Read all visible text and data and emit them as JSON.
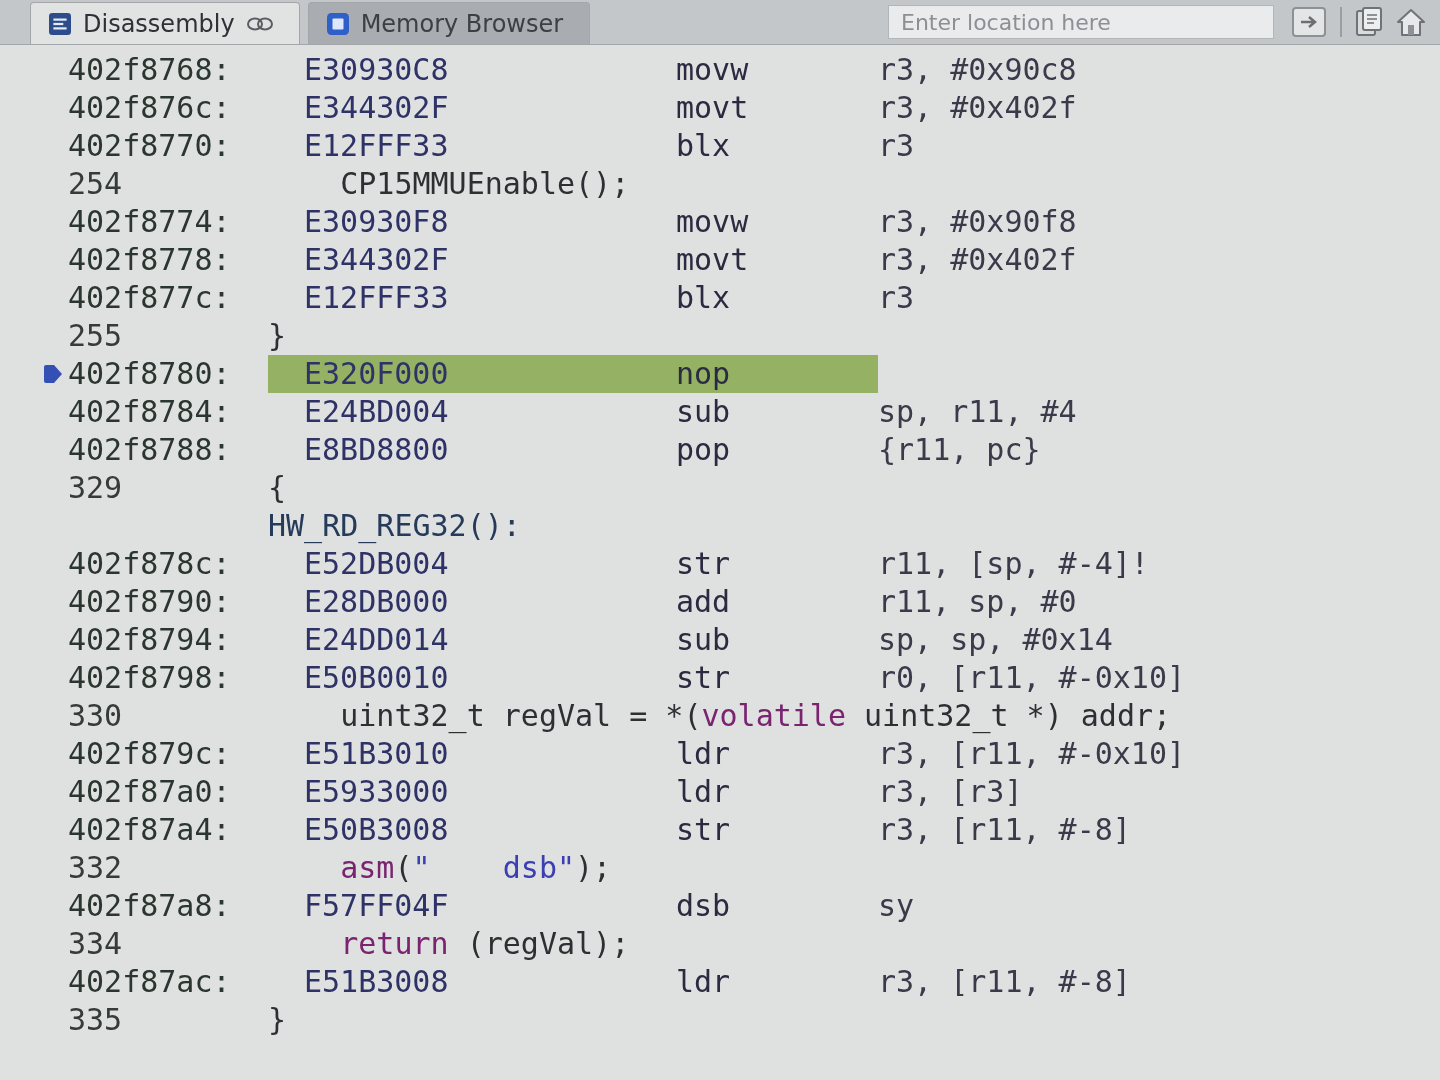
{
  "tabs": [
    {
      "label": "Disassembly",
      "selected": true
    },
    {
      "label": "Memory Browser",
      "selected": false
    }
  ],
  "location_field": {
    "placeholder": "Enter location here"
  },
  "rows": [
    {
      "kind": "instruction",
      "address": "402f8768:",
      "opcode": "E30930C8",
      "mnemonic": "movw",
      "operands": "r3, #0x90c8",
      "current": false
    },
    {
      "kind": "instruction",
      "address": "402f876c:",
      "opcode": "E344302F",
      "mnemonic": "movt",
      "operands": "r3, #0x402f",
      "current": false
    },
    {
      "kind": "instruction",
      "address": "402f8770:",
      "opcode": "E12FFF33",
      "mnemonic": "blx",
      "operands": "r3",
      "current": false
    },
    {
      "kind": "source",
      "line": "254",
      "code": [
        {
          "kind": "plain",
          "text": "    CP15MMUEnable();"
        }
      ]
    },
    {
      "kind": "instruction",
      "address": "402f8774:",
      "opcode": "E30930F8",
      "mnemonic": "movw",
      "operands": "r3, #0x90f8",
      "current": false
    },
    {
      "kind": "instruction",
      "address": "402f8778:",
      "opcode": "E344302F",
      "mnemonic": "movt",
      "operands": "r3, #0x402f",
      "current": false
    },
    {
      "kind": "instruction",
      "address": "402f877c:",
      "opcode": "E12FFF33",
      "mnemonic": "blx",
      "operands": "r3",
      "current": false
    },
    {
      "kind": "source",
      "line": "255",
      "code": [
        {
          "kind": "plain",
          "text": "}"
        }
      ]
    },
    {
      "kind": "instruction",
      "address": "402f8780:",
      "opcode": "E320F000",
      "mnemonic": "nop",
      "current": true
    },
    {
      "kind": "instruction",
      "address": "402f8784:",
      "opcode": "E24BD004",
      "mnemonic": "sub",
      "operands": "sp, r11, #4",
      "current": false
    },
    {
      "kind": "instruction",
      "address": "402f8788:",
      "opcode": "E8BD8800",
      "mnemonic": "pop",
      "operands": "{r11, pc}",
      "current": false
    },
    {
      "kind": "source",
      "line": "329",
      "code": [
        {
          "kind": "plain",
          "text": "{"
        }
      ]
    },
    {
      "kind": "label",
      "text": "HW_RD_REG32():"
    },
    {
      "kind": "instruction",
      "address": "402f878c:",
      "opcode": "E52DB004",
      "mnemonic": "str",
      "operands": "r11, [sp, #-4]!",
      "current": false
    },
    {
      "kind": "instruction",
      "address": "402f8790:",
      "opcode": "E28DB000",
      "mnemonic": "add",
      "operands": "r11, sp, #0",
      "current": false
    },
    {
      "kind": "instruction",
      "address": "402f8794:",
      "opcode": "E24DD014",
      "mnemonic": "sub",
      "operands": "sp, sp, #0x14",
      "current": false
    },
    {
      "kind": "instruction",
      "address": "402f8798:",
      "opcode": "E50B0010",
      "mnemonic": "str",
      "operands": "r0, [r11, #-0x10]",
      "current": false
    },
    {
      "kind": "source",
      "line": "330",
      "code": [
        {
          "kind": "plain",
          "text": "    uint32_t regVal = *("
        },
        {
          "kind": "keyword",
          "text": "volatile"
        },
        {
          "kind": "plain",
          "text": " uint32_t *) addr;"
        }
      ]
    },
    {
      "kind": "instruction",
      "address": "402f879c:",
      "opcode": "E51B3010",
      "mnemonic": "ldr",
      "operands": "r3, [r11, #-0x10]",
      "current": false
    },
    {
      "kind": "instruction",
      "address": "402f87a0:",
      "opcode": "E5933000",
      "mnemonic": "ldr",
      "operands": "r3, [r3]",
      "current": false
    },
    {
      "kind": "instruction",
      "address": "402f87a4:",
      "opcode": "E50B3008",
      "mnemonic": "str",
      "operands": "r3, [r11, #-8]",
      "current": false
    },
    {
      "kind": "source",
      "line": "332",
      "code": [
        {
          "kind": "keyword",
          "text": "    asm"
        },
        {
          "kind": "plain",
          "text": "("
        },
        {
          "kind": "string",
          "text": "\"    dsb\""
        },
        {
          "kind": "plain",
          "text": ");"
        }
      ]
    },
    {
      "kind": "instruction",
      "address": "402f87a8:",
      "opcode": "F57FF04F",
      "mnemonic": "dsb",
      "operands": "sy",
      "current": false
    },
    {
      "kind": "source",
      "line": "334",
      "code": [
        {
          "kind": "keyword",
          "text": "    return"
        },
        {
          "kind": "plain",
          "text": " (regVal);"
        }
      ]
    },
    {
      "kind": "instruction",
      "address": "402f87ac:",
      "opcode": "E51B3008",
      "mnemonic": "ldr",
      "operands": "r3, [r11, #-8]",
      "current": false
    },
    {
      "kind": "source",
      "line": "335",
      "code": [
        {
          "kind": "plain",
          "text": "}"
        }
      ]
    }
  ]
}
